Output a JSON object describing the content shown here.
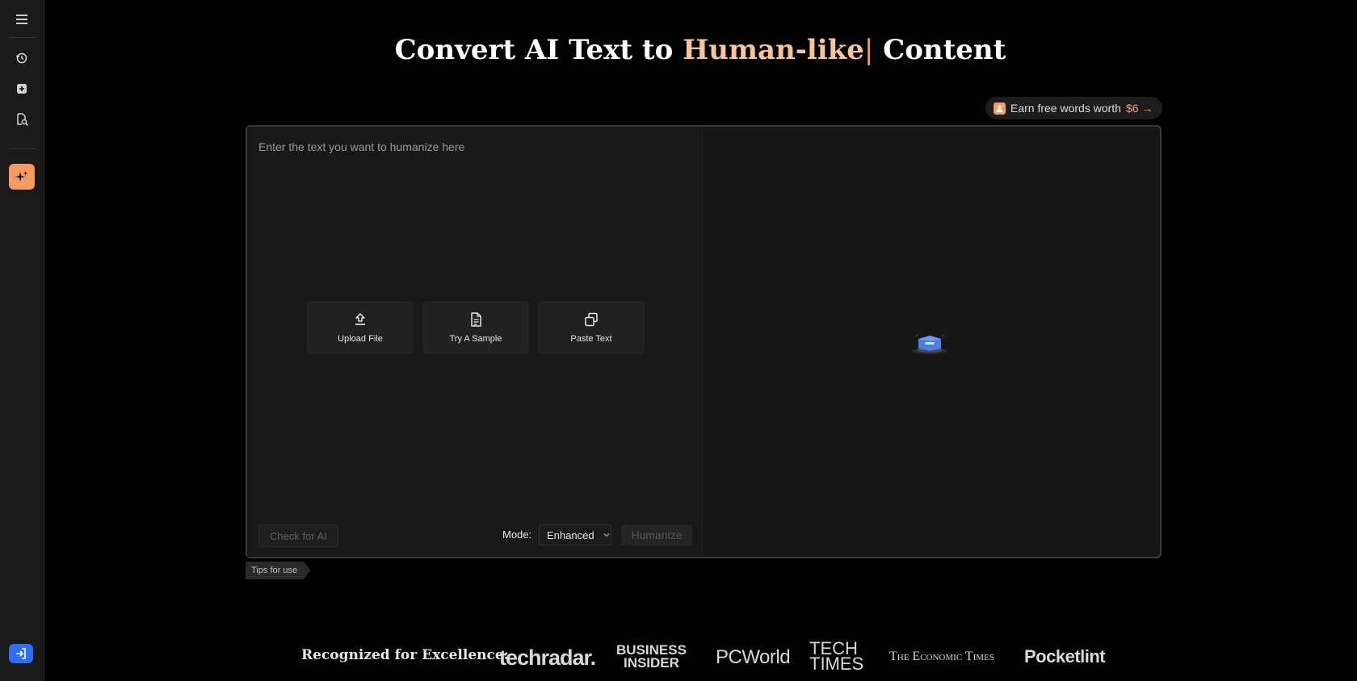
{
  "hero": {
    "title_pre": "Convert AI Text to ",
    "title_highlight": "Human-like",
    "title_cursor": "|",
    "title_post": " Content"
  },
  "earn": {
    "label": "Earn free words worth",
    "amount": "$6",
    "arrow": "→"
  },
  "editor": {
    "placeholder": "Enter the text you want to humanize here",
    "upload_label": "Upload File",
    "sample_label": "Try A Sample",
    "paste_label": "Paste Text",
    "check_label": "Check for AI",
    "mode_label": "Mode:",
    "mode_value": "Enhanced",
    "humanize_label": "Humanize"
  },
  "tips_label": "Tips for use",
  "recognized": {
    "label": "Recognized for Excellence:",
    "logos": {
      "techradar": "techradar.",
      "bi_line1": "BUSINESS",
      "bi_line2": "INSIDER",
      "pcworld": "PCWorld",
      "tt_line1": "TECH",
      "tt_line2": "TIMES",
      "et": "The Economic Times",
      "pocketlint": "Pocketlint"
    }
  },
  "sidebar": {
    "icons": [
      "menu-icon",
      "history-icon",
      "add-icon",
      "document-search-icon",
      "sparkle-icon",
      "login-icon"
    ]
  },
  "colors": {
    "accent": "#f59a63",
    "highlight": "#f6c59e",
    "login": "#2f6ef6"
  }
}
